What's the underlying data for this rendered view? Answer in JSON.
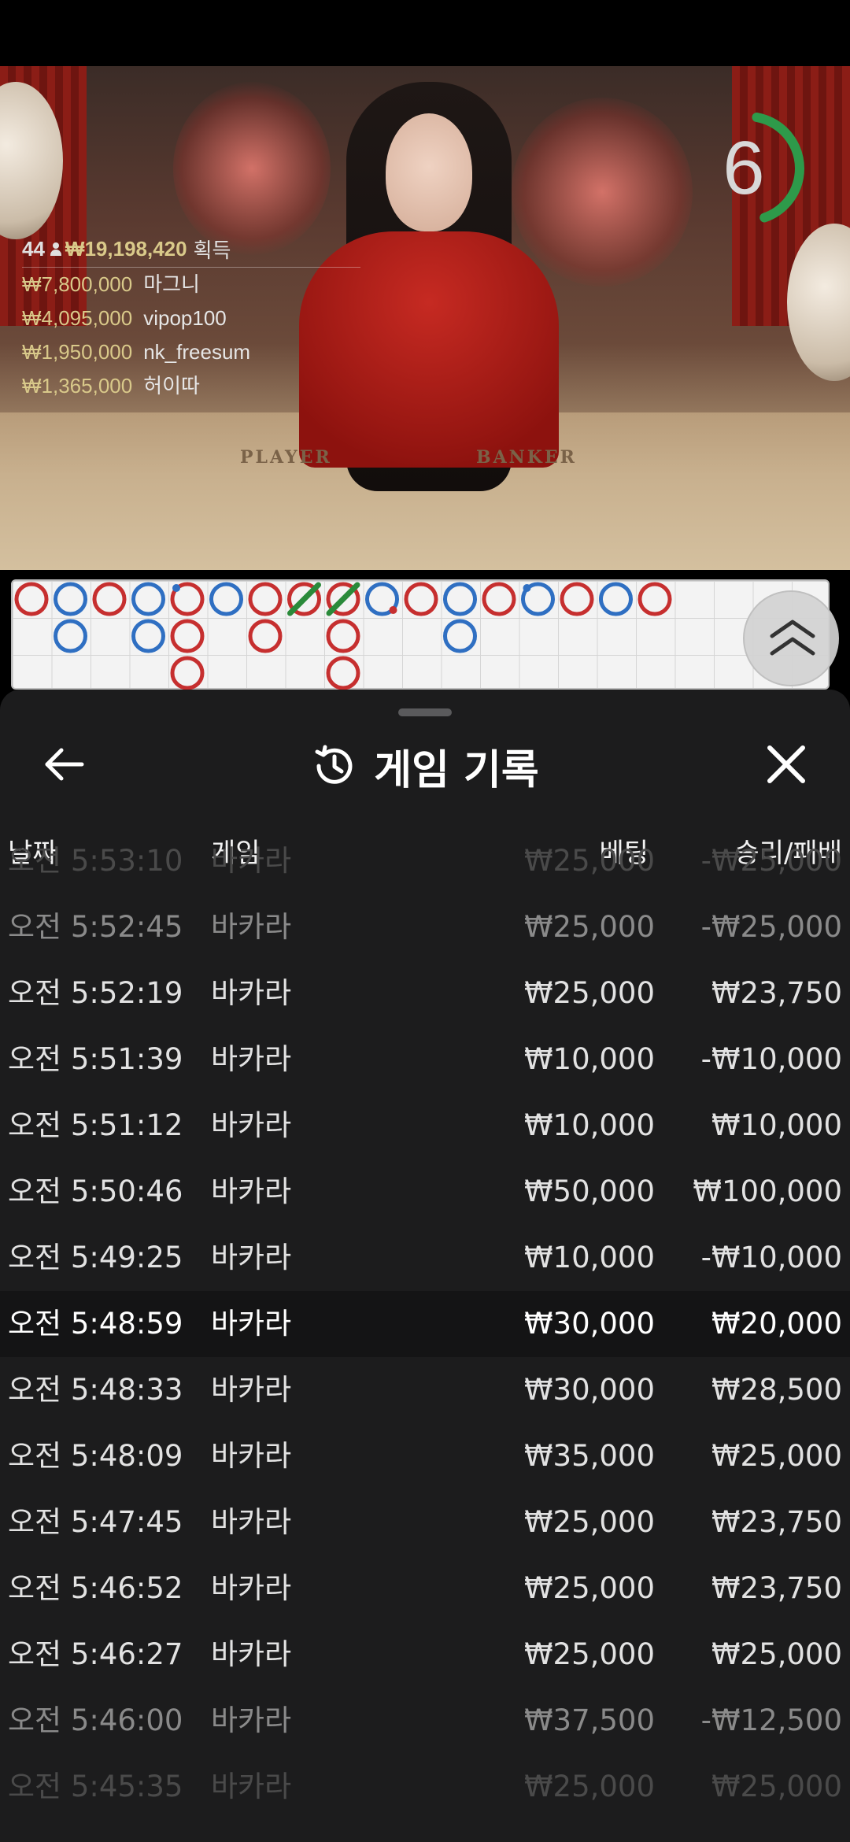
{
  "timer": {
    "value": "6",
    "progress": 0.42,
    "color": "#2e9a4a"
  },
  "leaderboard": {
    "player_count": "44",
    "total_win": "₩19,198,420",
    "total_suffix": "획득",
    "winners": [
      {
        "amount": "₩7,800,000",
        "name": "마그니"
      },
      {
        "amount": "₩4,095,000",
        "name": "vipop100"
      },
      {
        "amount": "₩1,950,000",
        "name": "nk_freesum"
      },
      {
        "amount": "₩1,365,000",
        "name": "허이따"
      }
    ]
  },
  "table_labels": {
    "player": "PLAYER",
    "banker": "BANKER"
  },
  "road": {
    "colors": {
      "banker": "#c62f2f",
      "player": "#2f6fc2",
      "tie": "#2a8a3a"
    },
    "columns": [
      {
        "col": 0,
        "result": "B",
        "rows": 1
      },
      {
        "col": 1,
        "result": "P",
        "rows": 2
      },
      {
        "col": 2,
        "result": "B",
        "rows": 1
      },
      {
        "col": 3,
        "result": "P",
        "rows": 2
      },
      {
        "col": 4,
        "result": "B",
        "rows": 3,
        "pair_first": "player"
      },
      {
        "col": 5,
        "result": "P",
        "rows": 1
      },
      {
        "col": 6,
        "result": "B",
        "rows": 2
      },
      {
        "col": 7,
        "result": "tie-B",
        "rows": 1
      },
      {
        "col": 8,
        "result": "tie-B",
        "rows": 3
      },
      {
        "col": 9,
        "result": "P",
        "rows": 1,
        "pair_first": "banker"
      },
      {
        "col": 10,
        "result": "B",
        "rows": 1
      },
      {
        "col": 11,
        "result": "P",
        "rows": 2
      },
      {
        "col": 12,
        "result": "B",
        "rows": 1
      },
      {
        "col": 13,
        "result": "P",
        "rows": 1,
        "pair_first": "player"
      },
      {
        "col": 14,
        "result": "B",
        "rows": 1
      },
      {
        "col": 15,
        "result": "P",
        "rows": 1
      },
      {
        "col": 16,
        "result": "B",
        "rows": 1
      }
    ]
  },
  "sheet": {
    "title": "게임 기록",
    "back_icon": "arrow-left-icon",
    "history_icon": "history-icon",
    "close_icon": "close-icon",
    "columns": {
      "date": "날짜",
      "game": "게임",
      "bet": "베팅",
      "result": "승리/패배"
    },
    "rows": [
      {
        "time": "오전 5:53:10",
        "game": "바카라",
        "bet": "₩25,000",
        "result": "-₩25,000",
        "style": "ghost"
      },
      {
        "time": "오전 5:52:45",
        "game": "바카라",
        "bet": "₩25,000",
        "result": "-₩25,000",
        "style": "dim"
      },
      {
        "time": "오전 5:52:19",
        "game": "바카라",
        "bet": "₩25,000",
        "result": "₩23,750",
        "style": ""
      },
      {
        "time": "오전 5:51:39",
        "game": "바카라",
        "bet": "₩10,000",
        "result": "-₩10,000",
        "style": ""
      },
      {
        "time": "오전 5:51:12",
        "game": "바카라",
        "bet": "₩10,000",
        "result": "₩10,000",
        "style": ""
      },
      {
        "time": "오전 5:50:46",
        "game": "바카라",
        "bet": "₩50,000",
        "result": "₩100,000",
        "style": ""
      },
      {
        "time": "오전 5:49:25",
        "game": "바카라",
        "bet": "₩10,000",
        "result": "-₩10,000",
        "style": ""
      },
      {
        "time": "오전 5:48:59",
        "game": "바카라",
        "bet": "₩30,000",
        "result": "₩20,000",
        "style": "hl"
      },
      {
        "time": "오전 5:48:33",
        "game": "바카라",
        "bet": "₩30,000",
        "result": "₩28,500",
        "style": ""
      },
      {
        "time": "오전 5:48:09",
        "game": "바카라",
        "bet": "₩35,000",
        "result": "₩25,000",
        "style": ""
      },
      {
        "time": "오전 5:47:45",
        "game": "바카라",
        "bet": "₩25,000",
        "result": "₩23,750",
        "style": ""
      },
      {
        "time": "오전 5:46:52",
        "game": "바카라",
        "bet": "₩25,000",
        "result": "₩23,750",
        "style": ""
      },
      {
        "time": "오전 5:46:27",
        "game": "바카라",
        "bet": "₩25,000",
        "result": "₩25,000",
        "style": ""
      },
      {
        "time": "오전 5:46:00",
        "game": "바카라",
        "bet": "₩37,500",
        "result": "-₩12,500",
        "style": "dim"
      },
      {
        "time": "오전 5:45:35",
        "game": "바카라",
        "bet": "₩25,000",
        "result": "₩25,000",
        "style": "ghost"
      }
    ]
  }
}
